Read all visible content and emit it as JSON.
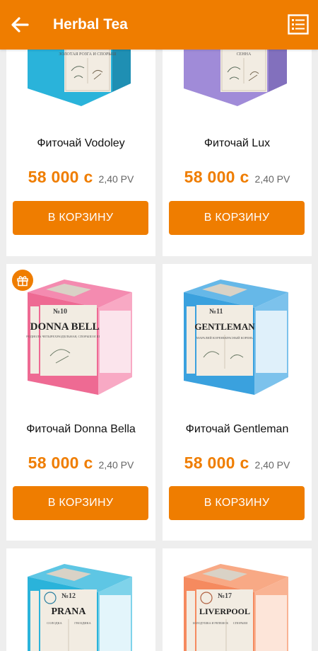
{
  "app_bar": {
    "title": "Herbal Tea",
    "back_icon": "arrow-left-icon",
    "list_icon": "list-view-icon",
    "background": "#ef7d00"
  },
  "products": [
    {
      "name": "Фиточай Vodoley",
      "price": "58 000 с",
      "pv": "2,40 PV",
      "button": "В КОРЗИНУ",
      "box_color": "#2ab3da",
      "box_label": "",
      "box_texts": [
        "ЗОЛОТАЯ РОЗГА И СПОРЫШ"
      ]
    },
    {
      "name": "Фиточай Lux",
      "price": "58 000 с",
      "pv": "2,40 PV",
      "button": "В КОРЗИНУ",
      "box_color": "#a08bd8",
      "box_label": "",
      "box_texts": [
        "СЕННА"
      ]
    },
    {
      "name": "Фиточай Donna Bella",
      "price": "58 000 с",
      "pv": "2,40 PV",
      "button": "В КОРЗИНУ",
      "box_color": "#ee6a93",
      "box_label": "DONNA BELLA",
      "box_number": "№10",
      "box_texts": [
        "РОДИОЛА ЧЕТЫРЕХРАЗДЕЛЬНАЯ, СПОРЫШ И ШАЛФЕЙ"
      ],
      "gift_icon": "gift-icon"
    },
    {
      "name": "Фиточай Gentleman",
      "price": "58 000 с",
      "pv": "2,40 PV",
      "button": "В КОРЗИНУ",
      "box_color": "#3aa1de",
      "box_label": "GENTLEMAN",
      "box_number": "№11",
      "box_texts": [
        "МАРАЛИЙ КОРЕНЬ",
        "КРАСНЫЙ КОРЕНЬ"
      ]
    },
    {
      "name": "",
      "price": "",
      "pv": "",
      "button": "",
      "box_color": "#2ab3da",
      "box_label": "PRANA",
      "box_number": "№12",
      "box_texts": [
        "СОЛОДКА",
        "ГВОЗДИКА"
      ]
    },
    {
      "name": "",
      "price": "",
      "pv": "",
      "button": "",
      "box_color": "#f58a5f",
      "box_label": "LIVERPOOL",
      "box_number": "№17",
      "box_texts": [
        "БОЛОДУШКА И РЕПЕШОК",
        "СПОРЫШ"
      ]
    }
  ]
}
